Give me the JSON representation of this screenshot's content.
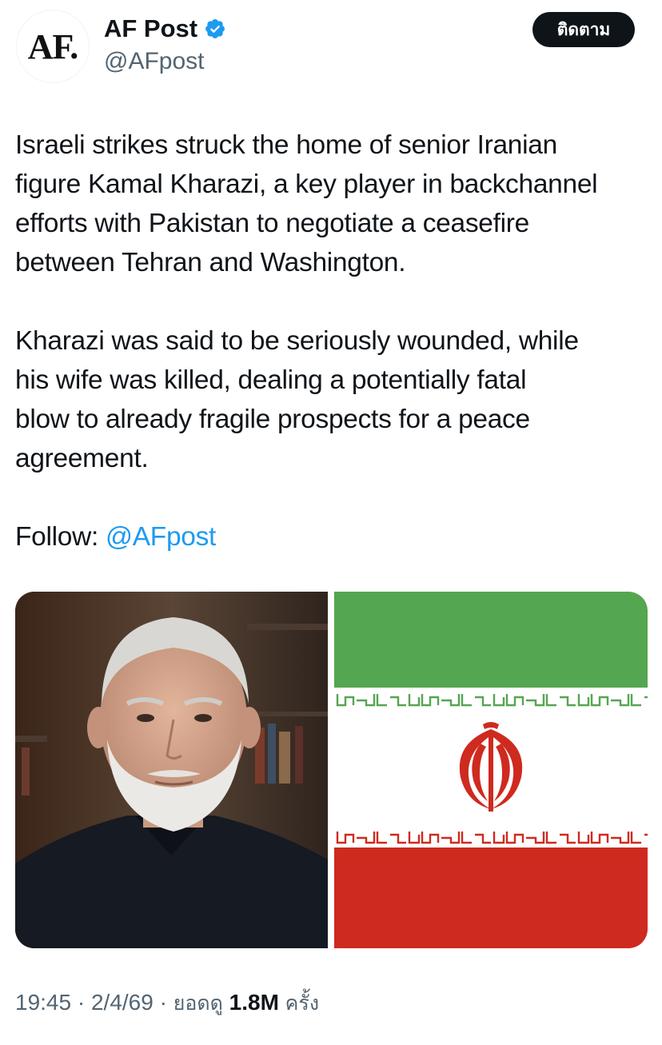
{
  "account": {
    "avatar_text": "AF.",
    "display_name": "AF Post",
    "handle": "@AFpost",
    "verified_color": "#1d9bf0"
  },
  "follow_button": {
    "label": "ติดตาม"
  },
  "tweet": {
    "paragraphs": [
      [
        "Israeli strikes struck the home of senior Iranian",
        "figure Kamal Kharazi, a key player in backchannel",
        "efforts with Pakistan to negotiate a ceasefire",
        "between Tehran and Washington."
      ],
      [
        "Kharazi was said to be seriously wounded, while",
        "his wife was killed, dealing a potentially fatal",
        "blow to already fragile prospects for a peace",
        "agreement."
      ]
    ],
    "follow_prefix": "Follow: ",
    "follow_mention": "@AFpost",
    "mention_color": "#1d9bf0"
  },
  "media": {
    "left_image": "portrait-photo",
    "right_image": "iran-flag",
    "flag_colors": {
      "green": "#55a650",
      "white": "#ffffff",
      "red": "#cf2a1f"
    }
  },
  "meta": {
    "time": "19:45",
    "separator": "·",
    "date": "2/4/69",
    "views_label": "ยอดดู",
    "views_count": "1.8M",
    "views_suffix": "ครั้ง"
  }
}
